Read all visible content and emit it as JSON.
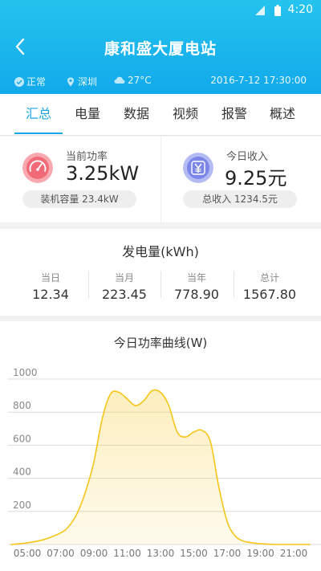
{
  "status_bar": {
    "time": "4:20"
  },
  "header": {
    "title": "康和盛大厦电站",
    "status": "正常",
    "location": "深圳",
    "temperature": "27°C",
    "datetime": "2016-7-12 17:30:00"
  },
  "tabs": [
    {
      "label": "汇总",
      "active": true
    },
    {
      "label": "电量",
      "active": false
    },
    {
      "label": "数据",
      "active": false
    },
    {
      "label": "视频",
      "active": false
    },
    {
      "label": "报警",
      "active": false
    },
    {
      "label": "概述",
      "active": false
    }
  ],
  "power": {
    "label": "当前功率",
    "value": "3.25kW",
    "capacity_label": "装机容量 23.4kW",
    "icon": "gauge-icon",
    "color": "#f06b77"
  },
  "income": {
    "label": "今日收入",
    "value": "9.25元",
    "total_label": "总收入 1234.5元",
    "icon": "yen-icon",
    "color": "#7b86e8"
  },
  "generation": {
    "title": "发电量(kWh)",
    "items": [
      {
        "label": "当日",
        "value": "12.34"
      },
      {
        "label": "当月",
        "value": "223.45"
      },
      {
        "label": "当年",
        "value": "778.90"
      },
      {
        "label": "总计",
        "value": "1567.80"
      }
    ]
  },
  "chart_data": {
    "type": "area",
    "title": "今日功率曲线(W)",
    "xlabel": "",
    "ylabel": "",
    "x_ticks": [
      "05:00",
      "07:00",
      "09:00",
      "11:00",
      "13:00",
      "15:00",
      "17:00",
      "19:00",
      "21:00"
    ],
    "y_ticks": [
      200,
      400,
      600,
      800,
      1000
    ],
    "ylim": [
      0,
      1000
    ],
    "grid": true,
    "color": "#f5c518",
    "series": [
      {
        "x": [
          "04:00",
          "05:00",
          "06:00",
          "07:00",
          "07:30",
          "08:00",
          "08:30",
          "09:00",
          "09:30",
          "10:00",
          "10:30",
          "11:00",
          "11:30",
          "12:00",
          "12:30",
          "13:00",
          "13:30",
          "14:00",
          "14:30",
          "15:00",
          "15:30",
          "16:00",
          "16:30",
          "17:00",
          "17:30",
          "18:00",
          "18:30",
          "19:00",
          "20:00",
          "21:00",
          "22:00"
        ],
        "values": [
          0,
          10,
          30,
          70,
          110,
          190,
          320,
          500,
          760,
          910,
          920,
          880,
          840,
          870,
          930,
          920,
          840,
          680,
          650,
          680,
          690,
          620,
          350,
          140,
          50,
          20,
          10,
          5,
          0,
          0,
          0
        ]
      }
    ]
  }
}
